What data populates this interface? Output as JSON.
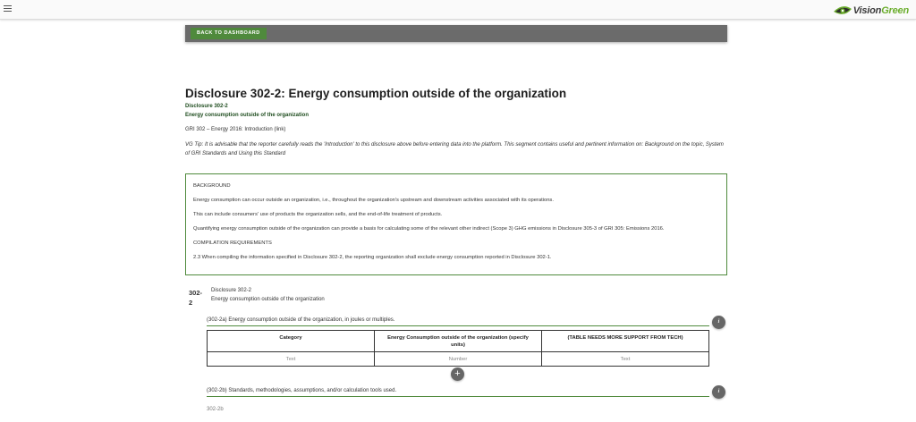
{
  "header": {
    "logo": {
      "part1": "Vision",
      "part2": "Green",
      "icon": "eye-leaf-icon",
      "icon_color": "#6cae2e"
    },
    "menu_icon": "hamburger-icon"
  },
  "toolbar": {
    "back_label": "BACK TO DASHBOARD",
    "accent": "#4f8a3c"
  },
  "disclosure": {
    "title": "Disclosure 302-2: Energy consumption outside of the organization",
    "code": "Disclosure 302-2",
    "name": "Energy consumption outside of the organization",
    "intro": "GRI 302 – Energy 2016: Introduction (link)",
    "tip": "VG Tip: It is advisable that the reporter carefully reads the 'Introduction' to this disclosure above before entering data into the platform. This segment contains useful and pertinent information on: Background on the topic, System of GRI Standards and Using this Standard"
  },
  "background_box": {
    "heading": "BACKGROUND",
    "p1": "Energy consumption can occur outside an organization, i.e., throughout the organization's upstream and downstream activities associated with its operations.",
    "p2": "This can include consumers' use of products the organization sells, and the end-of-life treatment of products.",
    "p3": "Quantifying energy consumption outside of the organization can provide a basis for calculating some of the relevant other indirect (Scope 3) GHG emissions in Disclosure 305-3 of GRI 305: Emissions 2016.",
    "compilation_heading": "COMPILATION REQUIREMENTS",
    "p4": "2.3 When compiling the information specified in Disclosure 302-2, the reporting organization shall exclude energy consumption reported in Disclosure 302-1."
  },
  "section": {
    "number": "302-2",
    "title1": "Disclosure 302-2",
    "title2": "Energy consumption outside of the organization"
  },
  "q_a": {
    "label": "(302-2a) Energy consumption outside of the organization, in joules or multiples.",
    "info": "i",
    "table": {
      "headers": [
        "Category",
        "Energy Consumption outside of the organization (specify units)",
        "(TABLE NEEDS MORE SUPPORT FROM TECH)"
      ],
      "row_placeholders": [
        "Text",
        "Number",
        "Text"
      ]
    },
    "add": "+"
  },
  "q_b": {
    "label": "(302-2b) Standards, methodologies, assumptions, and/or calculation tools used.",
    "info": "i",
    "field_label": "302-2b"
  }
}
